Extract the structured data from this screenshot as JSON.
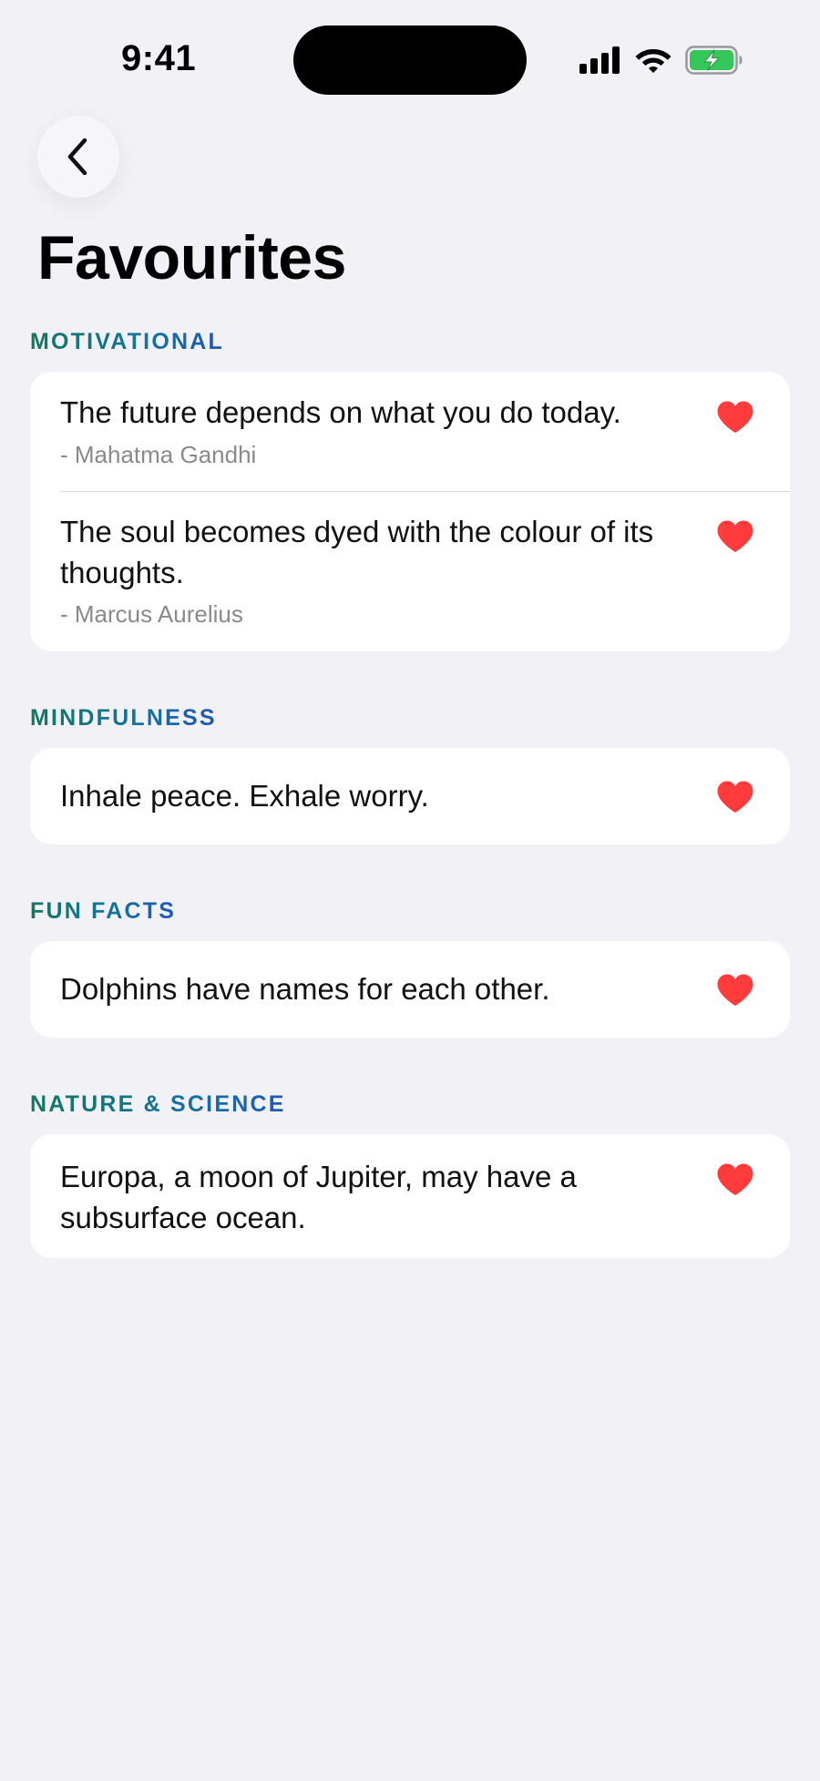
{
  "status_bar": {
    "time": "9:41"
  },
  "page": {
    "title": "Favourites"
  },
  "colors": {
    "background": "#F2F1F6",
    "card": "#FFFFFF",
    "heart": "#FF3B3B",
    "section_gradient_start": "#12785E",
    "section_gradient_end": "#2057B8",
    "author_text": "#8A8A8E",
    "battery_charging": "#34C759"
  },
  "icons": {
    "back": "chevron-left-icon",
    "favourite": "heart-filled-icon",
    "signal": "cellular-signal-icon",
    "wifi": "wifi-icon",
    "battery": "battery-charging-icon"
  },
  "sections": [
    {
      "title": "MOTIVATIONAL",
      "items": [
        {
          "text": "The future depends on what you do today.",
          "author": "- Mahatma Gandhi"
        },
        {
          "text": "The soul becomes dyed with the colour of its thoughts.",
          "author": "- Marcus Aurelius"
        }
      ]
    },
    {
      "title": "MINDFULNESS",
      "items": [
        {
          "text": "Inhale peace. Exhale worry."
        }
      ]
    },
    {
      "title": "FUN FACTS",
      "items": [
        {
          "text": "Dolphins have names for each other."
        }
      ]
    },
    {
      "title": "NATURE & SCIENCE",
      "items": [
        {
          "text": "Europa, a moon of Jupiter, may have a subsurface ocean."
        }
      ]
    }
  ]
}
